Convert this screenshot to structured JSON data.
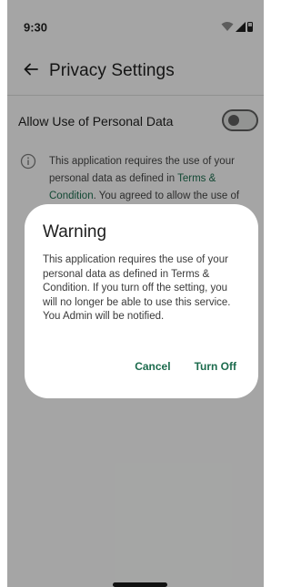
{
  "status_bar": {
    "time": "9:30",
    "icons": [
      "wifi-icon",
      "signal-icon",
      "battery-icon"
    ]
  },
  "app_bar": {
    "back_icon": "arrow-left-icon",
    "title": "Privacy Settings"
  },
  "setting": {
    "label": "Allow Use of Personal Data",
    "toggle_on": true
  },
  "info": {
    "icon": "info-icon",
    "text_prefix": "This application requires the use of your personal data as defined in ",
    "link_text": "Terms & Condition",
    "text_suffix": ". You agreed to allow the use of"
  },
  "dialog": {
    "title": "Warning",
    "body": "This application requires the use of your personal data as defined in Terms & Condition. If you turn off the setting, you will no longer be able to use this service. You Admin will be notified.",
    "cancel_label": "Cancel",
    "confirm_label": "Turn Off"
  },
  "colors": {
    "accent": "#1c6b4d",
    "background": "#f3f4f3",
    "scrim": "rgba(0,0,0,0.32)"
  }
}
